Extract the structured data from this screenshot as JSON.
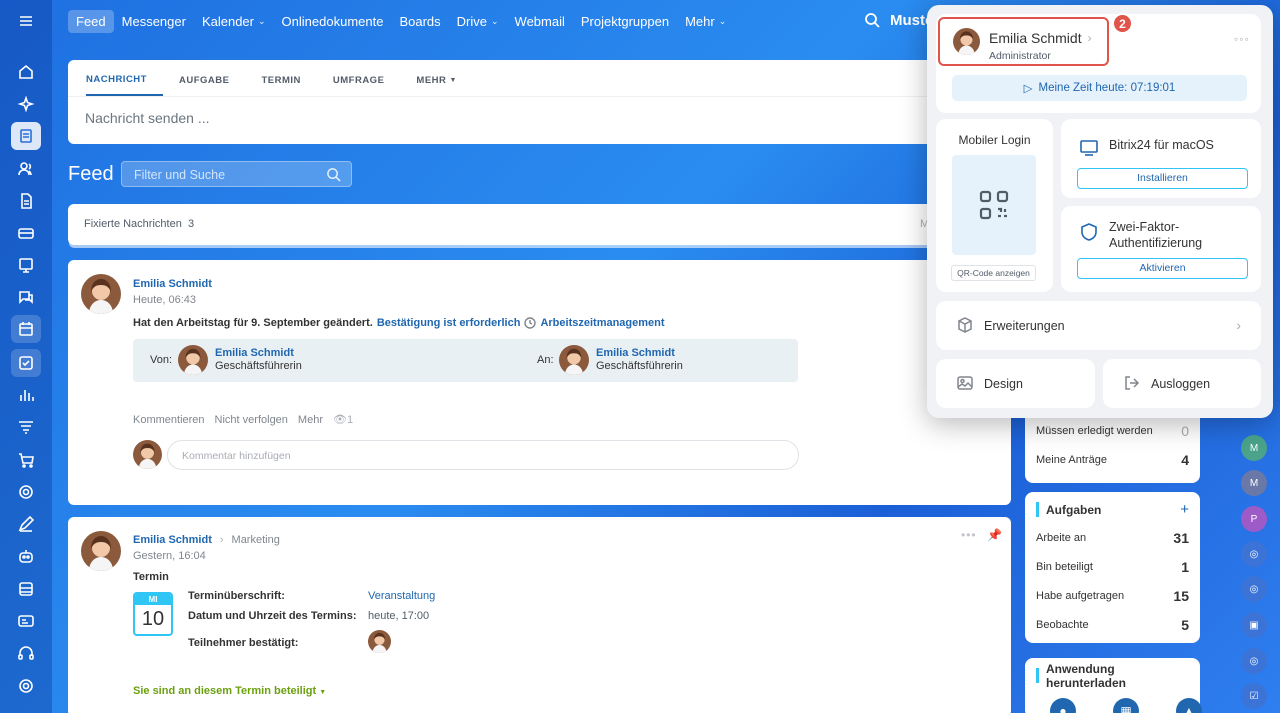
{
  "topnav": {
    "items": [
      {
        "label": "Feed",
        "caret": false
      },
      {
        "label": "Messenger",
        "caret": false
      },
      {
        "label": "Kalender",
        "caret": true
      },
      {
        "label": "Onlinedokumente",
        "caret": false
      },
      {
        "label": "Boards",
        "caret": false
      },
      {
        "label": "Drive",
        "caret": true
      },
      {
        "label": "Webmail",
        "caret": false
      },
      {
        "label": "Projektgruppen",
        "caret": false
      },
      {
        "label": "Mehr",
        "caret": true
      }
    ],
    "search_text": "Muste"
  },
  "composer": {
    "tabs": [
      "NACHRICHT",
      "AUFGABE",
      "TERMIN",
      "UMFRAGE",
      "MEHR"
    ],
    "placeholder": "Nachricht senden ..."
  },
  "feed": {
    "title": "Feed",
    "filter_placeholder": "Filter und Suche",
    "pinned_label": "Fixierte Nachrichten",
    "pinned_count": "3",
    "pinned_more": "M"
  },
  "post1": {
    "author": "Emilia Schmidt",
    "time": "Heute, 06:43",
    "text": "Hat den Arbeitstag für 9. September geändert.",
    "link": "Bestätigung ist erforderlich",
    "module": "Arbeitszeitmanagement",
    "from_label": "Von:",
    "from_name": "Emilia Schmidt",
    "from_role": "Geschäftsführerin",
    "to_label": "An:",
    "to_name": "Emilia Schmidt",
    "to_role": "Geschäftsführerin",
    "actions": [
      "Kommentieren",
      "Nicht verfolgen",
      "Mehr"
    ],
    "views": "1",
    "comment_placeholder": "Kommentar hinzufügen"
  },
  "post2": {
    "author": "Emilia Schmidt",
    "group": "Marketing",
    "time": "Gestern, 16:04",
    "type": "Termin",
    "cal_month": "MI",
    "cal_day": "10",
    "rows": [
      {
        "label": "Terminüberschrift:",
        "value": "Veranstaltung"
      },
      {
        "label": "Datum und Uhrzeit des Termins:",
        "value": "heute, 17:00"
      },
      {
        "label": "Teilnehmer bestätigt:",
        "value": ""
      }
    ],
    "status": "Sie sind an diesem Termin beteiligt"
  },
  "right": {
    "requests": [
      {
        "label": "Müssen erledigt werden",
        "value": "0"
      },
      {
        "label": "Meine Anträge",
        "value": "4"
      }
    ],
    "tasks_title": "Aufgaben",
    "tasks": [
      {
        "label": "Arbeite an",
        "value": "31"
      },
      {
        "label": "Bin beteiligt",
        "value": "1"
      },
      {
        "label": "Habe aufgetragen",
        "value": "15"
      },
      {
        "label": "Beobachte",
        "value": "5"
      }
    ],
    "download_title": "Anwendung herunterladen"
  },
  "right_rail": [
    "M",
    "M",
    "P"
  ],
  "popup": {
    "name": "Emilia Schmidt",
    "role": "Administrator",
    "badge": "2",
    "worktime": "Meine Zeit heute: 07:19:01",
    "mobile_title": "Mobiler Login",
    "qr_button": "QR-Code anzeigen",
    "mac_title": "Bitrix24 für macOS",
    "mac_button": "Installieren",
    "twofa_title": "Zwei-Faktor-Authentifizierung",
    "twofa_button": "Aktivieren",
    "extensions": "Erweiterungen",
    "design": "Design",
    "logout": "Ausloggen"
  },
  "colors": {
    "accent": "#2067b0",
    "highlight": "#e0544a",
    "green": "#6ba10e"
  }
}
